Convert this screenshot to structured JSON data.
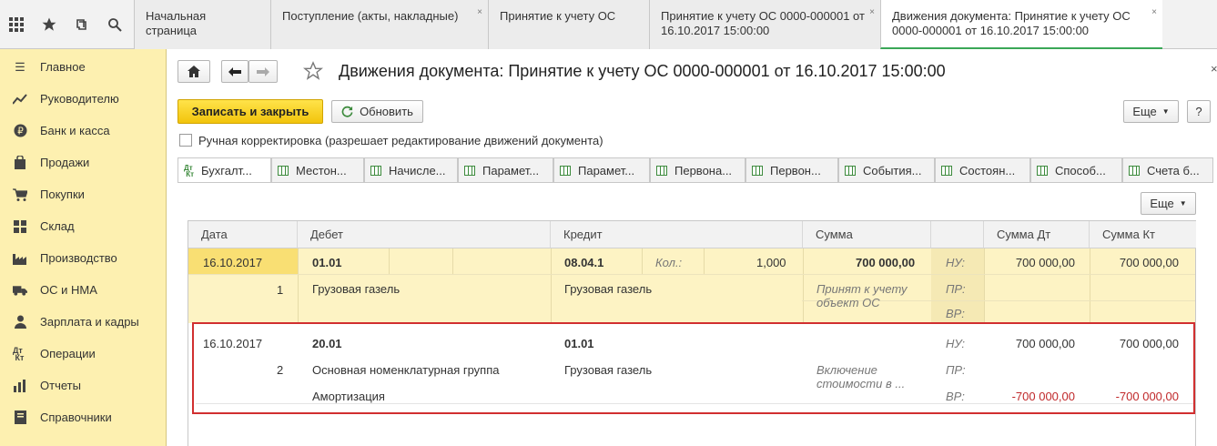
{
  "topbar": {
    "tabs": [
      {
        "label": "Начальная страница"
      },
      {
        "label": "Поступление (акты, накладные)",
        "close": "×"
      },
      {
        "label": "Принятие к учету ОС"
      },
      {
        "label": "Принятие к учету ОС 0000-000001 от 16.10.2017 15:00:00",
        "close": "×"
      },
      {
        "label": "Движения документа: Принятие к учету ОС 0000-000001 от 16.10.2017 15:00:00",
        "close": "×"
      }
    ]
  },
  "sidebar": {
    "items": [
      {
        "label": "Главное",
        "icon": "menu-icon"
      },
      {
        "label": "Руководителю",
        "icon": "trend-icon"
      },
      {
        "label": "Банк и касса",
        "icon": "ruble-icon"
      },
      {
        "label": "Продажи",
        "icon": "bag-icon"
      },
      {
        "label": "Покупки",
        "icon": "cart-icon"
      },
      {
        "label": "Склад",
        "icon": "warehouse-icon"
      },
      {
        "label": "Производство",
        "icon": "factory-icon"
      },
      {
        "label": "ОС и НМА",
        "icon": "truck-icon"
      },
      {
        "label": "Зарплата и кадры",
        "icon": "person-icon"
      },
      {
        "label": "Операции",
        "icon": "dt-kt-icon"
      },
      {
        "label": "Отчеты",
        "icon": "chart-icon"
      },
      {
        "label": "Справочники",
        "icon": "book-icon"
      }
    ]
  },
  "header": {
    "title": "Движения документа: Принятие к учету ОС 0000-000001 от 16.10.2017 15:00:00",
    "close": "×"
  },
  "toolbar": {
    "save_close": "Записать и закрыть",
    "refresh": "Обновить",
    "more": "Еще",
    "help": "?"
  },
  "manual_edit": {
    "label": "Ручная корректировка (разрешает редактирование движений документа)",
    "checked": false
  },
  "subtabs": [
    {
      "label": "Бухгалт..."
    },
    {
      "label": "Местон..."
    },
    {
      "label": "Начисле..."
    },
    {
      "label": "Парамет..."
    },
    {
      "label": "Парамет..."
    },
    {
      "label": "Первона..."
    },
    {
      "label": "Первон..."
    },
    {
      "label": "События..."
    },
    {
      "label": "Состоян..."
    },
    {
      "label": "Способ..."
    },
    {
      "label": "Счета б..."
    }
  ],
  "table_more": "Еще",
  "table": {
    "headers": [
      "Дата",
      "Дебет",
      "Кредит",
      "Сумма",
      "",
      "Сумма Дт",
      "Сумма Кт"
    ],
    "rows": [
      {
        "date": "16.10.2017",
        "num": "1",
        "debit": "01.01",
        "debit_sub": "Грузовая газель",
        "debit_sub2": "",
        "credit": "08.04.1",
        "qty_label": "Кол.:",
        "qty": "1,000",
        "credit_sub": "Грузовая газель",
        "sum": "700 000,00",
        "content": "Принят к учету объект ОС",
        "labels": [
          "НУ:",
          "ПР:",
          "ВР:"
        ],
        "dt": [
          "700 000,00",
          "",
          ""
        ],
        "kt": [
          "700 000,00",
          "",
          ""
        ]
      },
      {
        "date": "16.10.2017",
        "num": "2",
        "debit": "20.01",
        "debit_sub": "Основная номенклатурная группа",
        "debit_sub2": "Амортизация",
        "credit": "01.01",
        "credit_sub": "Грузовая газель",
        "sum": "",
        "content": "Включение стоимости в ...",
        "labels": [
          "НУ:",
          "ПР:",
          "ВР:"
        ],
        "dt": [
          "700 000,00",
          "",
          "-700 000,00"
        ],
        "kt": [
          "700 000,00",
          "",
          "-700 000,00"
        ]
      }
    ]
  },
  "colors": {
    "sidebar": "#fdf0b0",
    "selected_row": "#fdf3c4",
    "highlight": "#d12f30",
    "save_button": "#f5cc18"
  }
}
